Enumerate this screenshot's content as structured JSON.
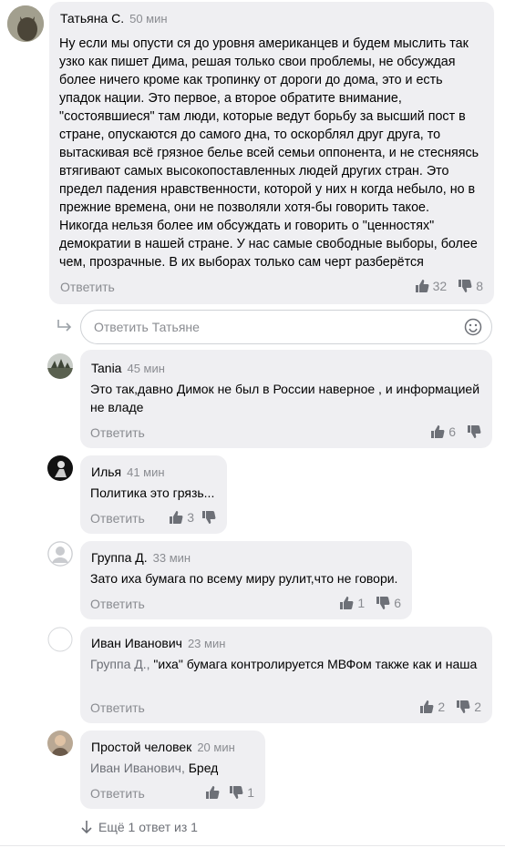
{
  "main_comment": {
    "author": "Татьяна С.",
    "time": "50 мин",
    "text": "Ну если мы опусти ся до уровня американцев и будем мыслить так узко как пишет Дима, решая только свои проблемы, не обсуждая более ничего кроме как тропинку от дороги до дома, это и есть упадок нации. Это первое, а второе обратите внимание, \"состоявшиеся\"  там люди, которые ведут борьбу за высший пост в стране, опускаются до самого дна, то оскорблял друг друга, то вытаскивая всё грязное белье  всей семьи оппонента, и не стесняясь втягивают самых высокопоставленных людей других стран. Это предел падения нравственности, которой у них н когда небыло, но в прежние времена, они не позволяли хотя-бы говорить такое. Никогда нельзя более им обсуждать и говорить о \"ценностях\" демократии в нашей стране. У нас самые свободные  выборы, более чем, прозрачные. В их выборах только сам черт разберётся",
    "reply_label": "Ответить",
    "likes": "32",
    "dislikes": "8"
  },
  "reply_input": {
    "placeholder": "Ответить Татьяне"
  },
  "replies": [
    {
      "author": "Tania",
      "time": "45 мин",
      "text": "Это так,давно Димок не был в России наверное , и информацией не владе",
      "reply_label": "Ответить",
      "likes": "6",
      "dislikes": ""
    },
    {
      "author": "Илья",
      "time": "41 мин",
      "text": "Политика это грязь...",
      "reply_label": "Ответить",
      "likes": "3",
      "dislikes": ""
    },
    {
      "author": "Группа Д.",
      "time": "33 мин",
      "text": "Зато иха бумага по всему миру рулит,что не говори.",
      "reply_label": "Ответить",
      "likes": "1",
      "dislikes": "6"
    },
    {
      "author": "Иван Иванович",
      "time": "23 мин",
      "mention": "Группа Д.,",
      "text": " \"иха\" бумага контролируется МВФом также как и наша",
      "reply_label": "Ответить",
      "likes": "2",
      "dislikes": "2"
    },
    {
      "author": "Простой человек",
      "time": "20 мин",
      "mention": "Иван Иванович,",
      "text": " Бред",
      "reply_label": "Ответить",
      "likes": "",
      "dislikes": "1"
    }
  ],
  "more_replies": "Ещё 1 ответ из 1",
  "colors": {
    "bubble": "#efeff2",
    "muted_text": "#8a8c91",
    "icon": "#6d7077"
  }
}
